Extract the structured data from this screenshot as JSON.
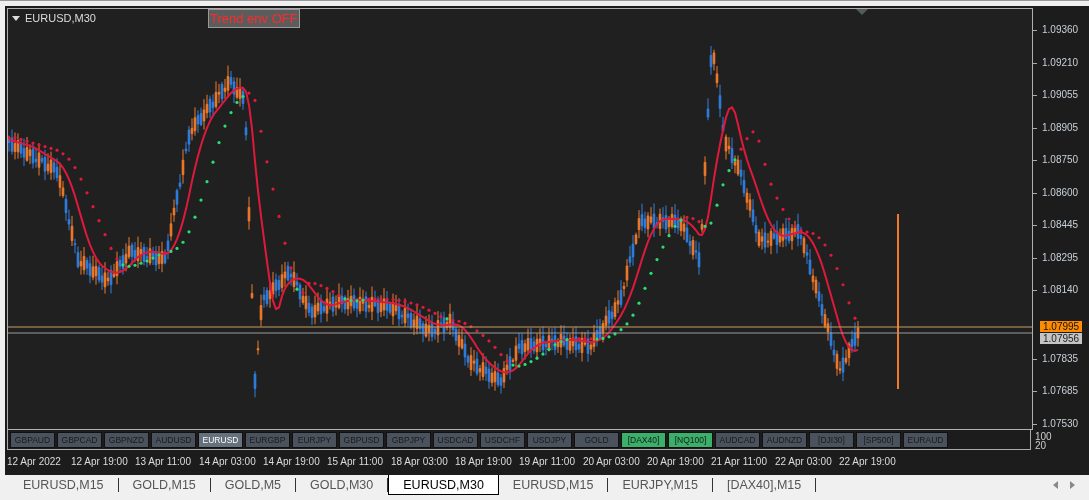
{
  "chart": {
    "title": "EURUSD,M30",
    "trend_button": "Trend env OFF"
  },
  "price_axis": [
    "1.09360",
    "1.09210",
    "1.09055",
    "1.08905",
    "1.08750",
    "1.08600",
    "1.08445",
    "1.08295",
    "1.08140",
    "1.07835",
    "1.07685",
    "1.07530"
  ],
  "current_prices": [
    {
      "kind": "bid",
      "label": "1.07995"
    },
    {
      "kind": "ask",
      "label": "1.07956"
    }
  ],
  "symbol_buttons": [
    {
      "label": "GBPAUD",
      "selected": false,
      "highlighted": false
    },
    {
      "label": "GBPCAD",
      "selected": false,
      "highlighted": false
    },
    {
      "label": "GBPNZD",
      "selected": false,
      "highlighted": false
    },
    {
      "label": "AUDUSD",
      "selected": false,
      "highlighted": false
    },
    {
      "label": "EURUSD",
      "selected": true,
      "highlighted": false
    },
    {
      "label": "EURGBP",
      "selected": false,
      "highlighted": false
    },
    {
      "label": "EURJPY",
      "selected": false,
      "highlighted": false
    },
    {
      "label": "GBPUSD",
      "selected": false,
      "highlighted": false
    },
    {
      "label": "GBPJPY",
      "selected": false,
      "highlighted": false
    },
    {
      "label": "USDCAD",
      "selected": false,
      "highlighted": false
    },
    {
      "label": "USDCHF",
      "selected": false,
      "highlighted": false
    },
    {
      "label": "USDJPY",
      "selected": false,
      "highlighted": false
    },
    {
      "label": "GOLD",
      "selected": false,
      "highlighted": false
    },
    {
      "label": "[DAX40]",
      "selected": false,
      "highlighted": true
    },
    {
      "label": "[NQ100]",
      "selected": false,
      "highlighted": true
    },
    {
      "label": "AUDCAD",
      "selected": false,
      "highlighted": false
    },
    {
      "label": "AUDNZD",
      "selected": false,
      "highlighted": false
    },
    {
      "label": "[DJI30]",
      "selected": false,
      "highlighted": false
    },
    {
      "label": "[SP500]",
      "selected": false,
      "highlighted": false
    },
    {
      "label": "EURAUD",
      "selected": false,
      "highlighted": false
    }
  ],
  "indicator_axis": [
    "100",
    "20"
  ],
  "time_axis": [
    "12 Apr 2022",
    "12 Apr 19:00",
    "13 Apr 11:00",
    "14 Apr 03:00",
    "14 Apr 19:00",
    "15 Apr 11:00",
    "18 Apr 03:00",
    "18 Apr 19:00",
    "19 Apr 11:00",
    "20 Apr 03:00",
    "20 Apr 19:00",
    "21 Apr 11:00",
    "22 Apr 03:00",
    "22 Apr 19:00"
  ],
  "tabs": [
    {
      "label": "EURUSD,M15",
      "selected": false
    },
    {
      "label": "GOLD,M15",
      "selected": false
    },
    {
      "label": "GOLD,M5",
      "selected": false
    },
    {
      "label": "GOLD,M30",
      "selected": false
    },
    {
      "label": "EURUSD,M30",
      "selected": true
    },
    {
      "label": "EURUSD,M15",
      "selected": false
    },
    {
      "label": "EURJPY,M15",
      "selected": false
    },
    {
      "label": "[DAX40],M15",
      "selected": false
    }
  ]
}
